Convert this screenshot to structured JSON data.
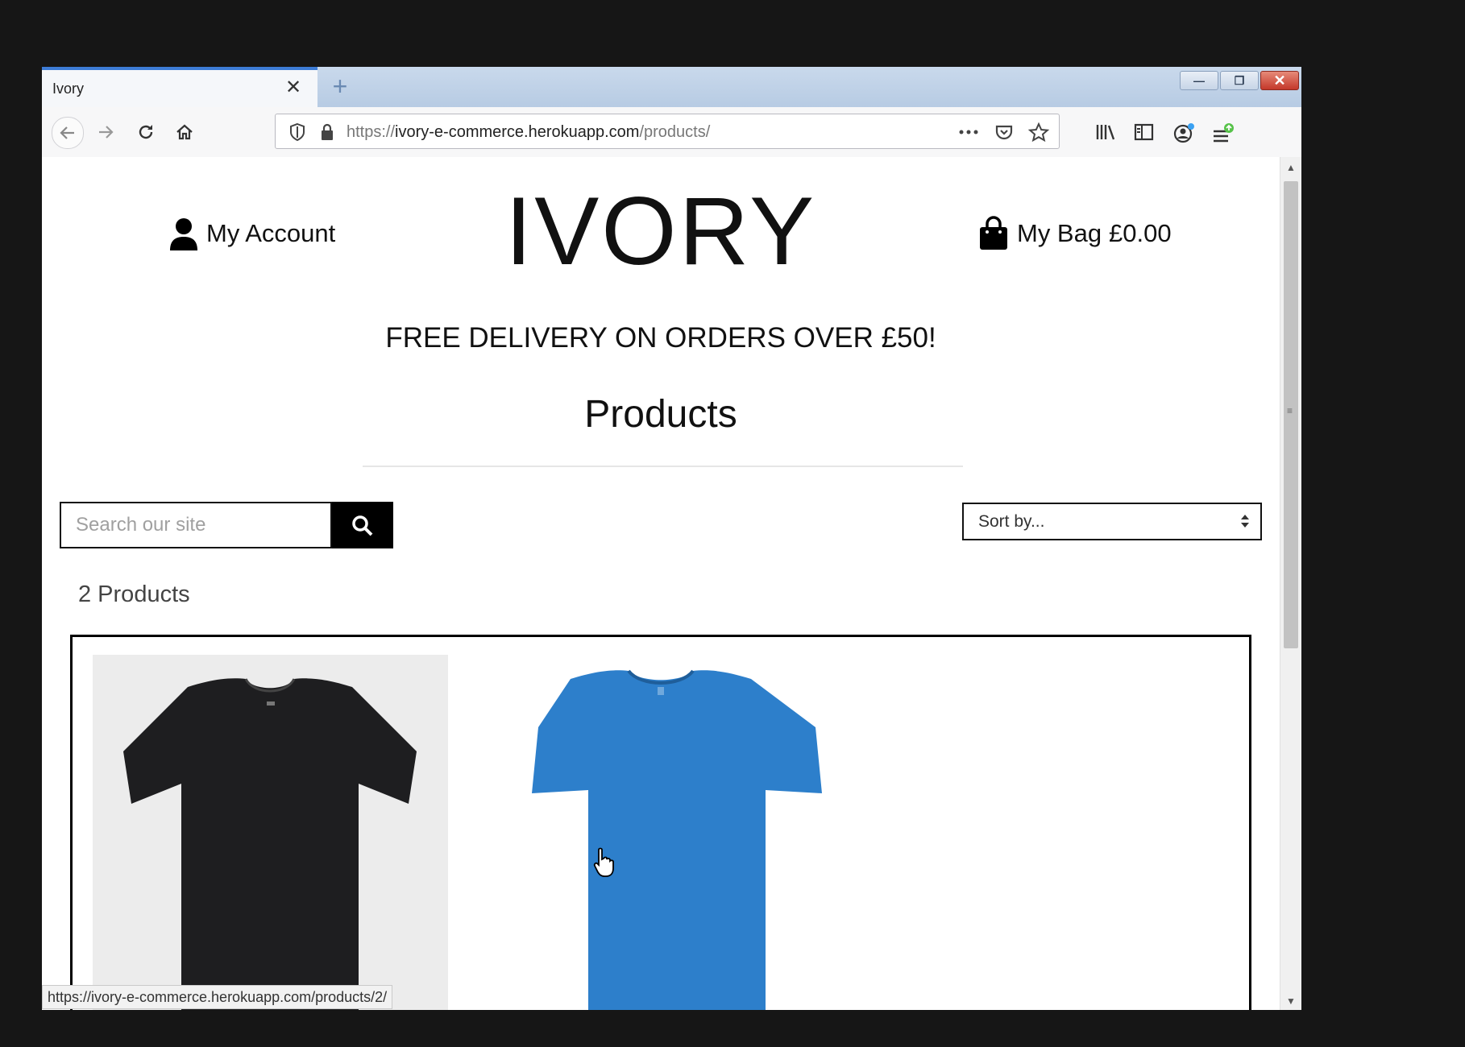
{
  "browser": {
    "tab_title": "Ivory",
    "tab_close": "✕",
    "new_tab": "+",
    "url_host_prefix": "https://",
    "url_host": "ivory-e-commerce.herokuapp.com",
    "url_path": "/products/",
    "status_url": "https://ivory-e-commerce.herokuapp.com/products/2/",
    "window_buttons": {
      "minimize": "—",
      "maximize": "❐",
      "close": "✕"
    }
  },
  "header": {
    "account_label": "My Account",
    "logo": "IVORY",
    "bag_label": "My Bag",
    "bag_total": "£0.00"
  },
  "banner": "FREE DELIVERY ON ORDERS OVER £50!",
  "page": {
    "title": "Products",
    "search_placeholder": "Search our site",
    "sort_label": "Sort by...",
    "product_count": "2 Products"
  },
  "products": [
    {
      "image": "black t-shirt",
      "color": "#1e1e20"
    },
    {
      "image": "blue t-shirt",
      "color": "#2d7fcb"
    }
  ]
}
